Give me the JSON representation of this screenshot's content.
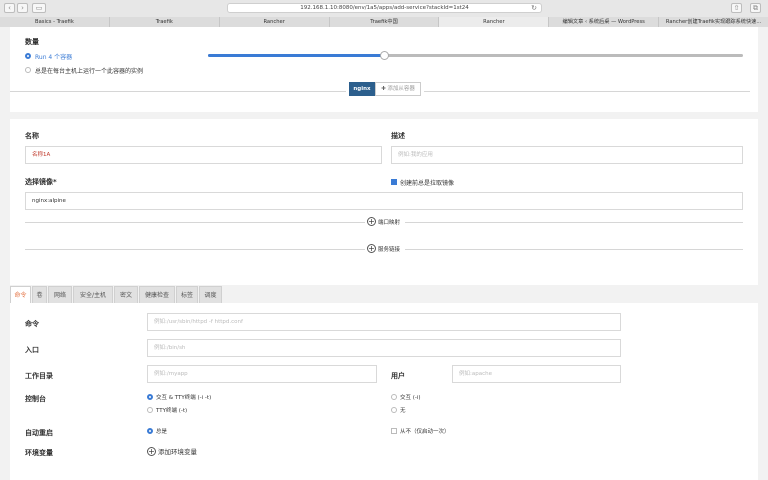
{
  "browser": {
    "url": "192.168.1.10:8080/env/1a5/apps/add-service?stackId=1st24",
    "tabs": [
      {
        "label": "Basics - Traefik"
      },
      {
        "label": "Traefik"
      },
      {
        "label": "Rancher"
      },
      {
        "label": "Traefik中国"
      },
      {
        "label": "Rancher",
        "active": true
      },
      {
        "label": "编辑文章 ‹ 系统后桌 — WordPress"
      },
      {
        "label": "Rancher创建Traefik实现跟踪系统快速..."
      }
    ]
  },
  "scale": {
    "title": "数量",
    "option_run": "Run 4 个容器",
    "option_global": "总是在每台主机上运行一个此容器的实例",
    "slider_fraction": 0.33
  },
  "containers": {
    "chip_label": "nginx",
    "add_sidekick_label": "添加从容器"
  },
  "form": {
    "name_label": "名称",
    "name_value": "名称1A",
    "desc_label": "描述",
    "desc_placeholder": "例如:我的应用",
    "image_label": "选择镜像*",
    "image_value": "nginx:alpine",
    "pull_image_label": "创建前总是拉取镜像",
    "port_map_label": "端口映射",
    "service_link_label": "服务链接"
  },
  "bottom_tabs": [
    {
      "label": "命令",
      "active": true
    },
    {
      "label": "卷"
    },
    {
      "label": "网络"
    },
    {
      "label": "安全/主机"
    },
    {
      "label": "密文"
    },
    {
      "label": "健康检查"
    },
    {
      "label": "标签"
    },
    {
      "label": "调度"
    }
  ],
  "command": {
    "command_label": "命令",
    "command_placeholder": "例如:/usr/sbin/httpd -f httpd.conf",
    "entry_label": "入口",
    "entry_placeholder": "例如:/bin/sh",
    "workdir_label": "工作目录",
    "workdir_placeholder": "例如:/myapp",
    "user_label": "用户",
    "user_placeholder": "例如:apache",
    "console_label": "控制台",
    "console_opt1": "交互 & TTY终端 (-i -t)",
    "console_opt2": "TTY终端 (-t)",
    "console_opt3": "交互 (-i)",
    "console_opt4": "无",
    "restart_label": "自动重启",
    "restart_opt1": "总是",
    "restart_opt2": "从不（仅启动一次）",
    "env_label": "环境变量",
    "env_add_label": "添加环境变量"
  }
}
